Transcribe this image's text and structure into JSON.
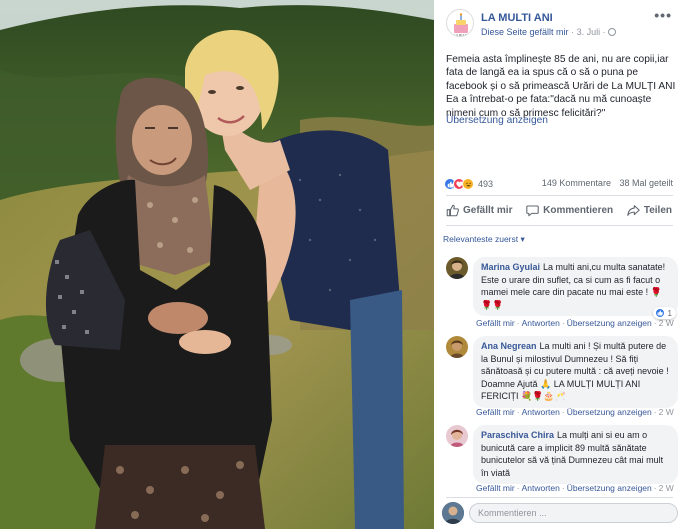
{
  "page": {
    "name": "LA MULTI ANI",
    "liked_label": "Diese Seite gefällt mir",
    "date": "3. Juli",
    "more_label": "•••"
  },
  "post": {
    "text": "Femeia asta împlinește 85 de ani, nu are copii,iar fata de langă ea ia spus că o să o puna pe facebook și o să primească Urări de La MULȚI ANI Ea a întrebat-o pe fata:\"dacă nu mă cunoaște nimeni cum o să primesc felicitări?\"",
    "translate_label": "Übersetzung anzeigen",
    "reaction_count": "493",
    "comment_count": "149 Kommentare",
    "share_count": "38 Mal geteilt"
  },
  "actions": {
    "like": "Gefällt mir",
    "comment": "Kommentieren",
    "share": "Teilen"
  },
  "comments_sort": "Relevanteste zuerst",
  "comments": [
    {
      "author": "Marina Gyulai",
      "text": "La multi ani,cu multa sanatate! Este o urare din suflet, ca si cum as fi facut o mamei mele care din pacate nu mai este ! 🌹🌹🌹",
      "like": "Gefällt mir",
      "reply": "Antworten",
      "translate": "Übersetzung anzeigen",
      "time": "2 W",
      "likes": "1"
    },
    {
      "author": "Ana Negrean",
      "text": "La multi ani ! Și multă putere de la Bunul și milostivul Dumnezeu ! Să fiți sănătoasă și cu putere multă : că aveți nevoie ! Doamne Ajută 🙏 LA MULȚI MULȚI ANI FERICIȚI 💐🌹🎂🥂",
      "like": "Gefällt mir",
      "reply": "Antworten",
      "translate": "Übersetzung anzeigen",
      "time": "2 W"
    },
    {
      "author": "Paraschiva Chira",
      "text": "La mulți ani si eu am o bunicută care a implicit 89 multă sănătate bunicutelor să vă țină Dumnezeu cât mai mult în viată",
      "like": "Gefällt mir",
      "reply": "Antworten",
      "translate": "Übersetzung anzeigen",
      "time": "2 W"
    }
  ],
  "composer": {
    "placeholder": "Kommentieren ..."
  },
  "colors": {
    "link": "#365899",
    "reaction_like": "#3578e5",
    "reaction_love": "#f33e58",
    "reaction_haha": "#f7b125"
  },
  "icons": [
    "page-avatar-icon",
    "globe-icon",
    "more-icon",
    "like-reaction-icon",
    "love-reaction-icon",
    "haha-reaction-icon",
    "thumbs-up-icon",
    "comment-icon",
    "share-icon",
    "chevron-down-icon"
  ]
}
